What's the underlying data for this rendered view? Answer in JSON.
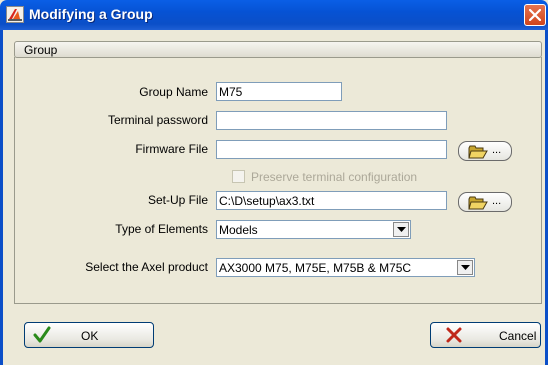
{
  "window": {
    "title": "Modifying a Group"
  },
  "group": {
    "header": "Group",
    "group_name": {
      "label": "Group Name",
      "value": "M75"
    },
    "terminal_password": {
      "label": "Terminal password",
      "value": ""
    },
    "firmware_file": {
      "label": "Firmware File",
      "value": "",
      "browse_label": "..."
    },
    "preserve_config": {
      "label": "Preserve terminal configuration",
      "checked": false,
      "enabled": false
    },
    "setup_file": {
      "label": "Set-Up File",
      "value": "C:\\D\\setup\\ax3.txt",
      "browse_label": "..."
    },
    "type_of_elements": {
      "label": "Type of Elements",
      "value": "Models"
    },
    "axel_product": {
      "label": "Select the Axel product",
      "value": "AX3000 M75, M75E, M75B & M75C"
    }
  },
  "buttons": {
    "ok_label": "OK",
    "cancel_label": "Cancel"
  },
  "icons": {
    "app": "axel-app-icon",
    "close": "close-icon",
    "folder": "folder-open-icon",
    "ok": "check-icon",
    "cancel": "x-icon",
    "dropdown": "chevron-down-icon"
  },
  "colors": {
    "titlebar": "#0652d4",
    "dialog_bg": "#ece9d8",
    "close_button": "#d0451b",
    "ok_check": "#2a8a1a",
    "cancel_x": "#c0281a"
  }
}
